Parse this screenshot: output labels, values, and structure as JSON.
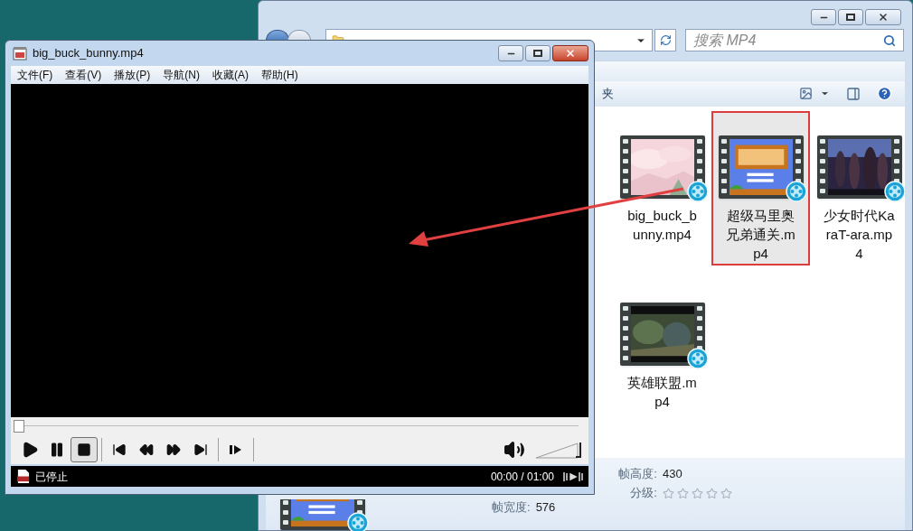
{
  "explorer": {
    "search": {
      "placeholder": "搜索 MP4"
    },
    "toolbar": {
      "label": "夹"
    },
    "files": [
      {
        "name": "big_buck_bunny.mp4",
        "selected": false
      },
      {
        "name": "超级马里奥兄弟通关.mp4",
        "selected": true
      },
      {
        "name": "少女时代KaraT-ara.mp4",
        "selected": false
      },
      {
        "name": "英雄联盟.mp4",
        "selected": false
      }
    ],
    "details": {
      "frame_width": {
        "label": "帧宽度:",
        "value": "576"
      },
      "frame_height": {
        "label": "帧高度:",
        "value": "430"
      },
      "rating": {
        "label": "分级:",
        "stars": 0
      }
    }
  },
  "player": {
    "title": "big_buck_bunny.mp4",
    "menu": [
      "文件(F)",
      "查看(V)",
      "播放(P)",
      "导航(N)",
      "收藏(A)",
      "帮助(H)"
    ],
    "seek": {
      "level": 0
    },
    "controls": [
      {
        "kind": "play",
        "selected": false
      },
      {
        "kind": "pause",
        "selected": false
      },
      {
        "kind": "stop",
        "selected": true
      },
      {
        "kind": "separator"
      },
      {
        "kind": "previous",
        "selected": false
      },
      {
        "kind": "rewind",
        "selected": false
      },
      {
        "kind": "forward",
        "selected": false
      },
      {
        "kind": "next",
        "selected": false
      },
      {
        "kind": "separator"
      },
      {
        "kind": "frame-step",
        "selected": false
      },
      {
        "kind": "separator"
      }
    ],
    "volume": {
      "level": 1
    },
    "status": "已停止",
    "time": "00:00 / 01:00"
  }
}
